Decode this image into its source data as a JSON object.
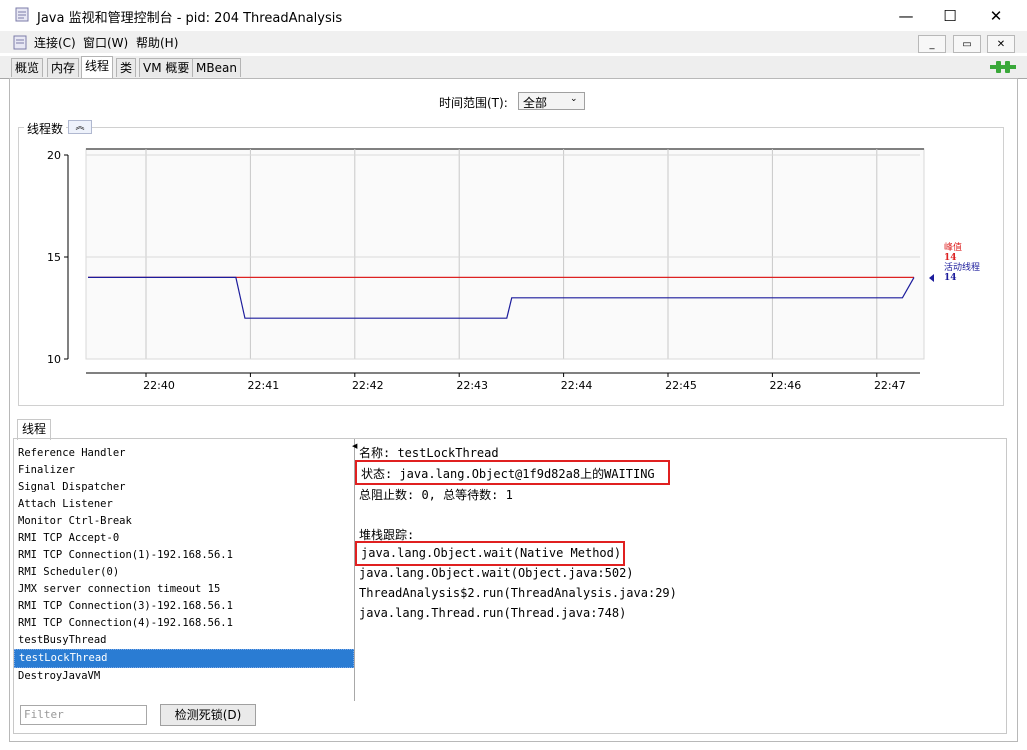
{
  "window": {
    "title": "Java 监视和管理控制台 - pid: 204 ThreadAnalysis",
    "controls": {
      "minimize": "—",
      "maximize": "☐",
      "close": "✕"
    }
  },
  "menu": {
    "items": [
      "连接(C)",
      "窗口(W)",
      "帮助(H)"
    ],
    "mdi_controls": [
      "_",
      "▭",
      "✕"
    ]
  },
  "tabs": [
    "概览",
    "内存",
    "线程",
    "类",
    "VM 概要",
    "MBean"
  ],
  "active_tab": "线程",
  "time_range": {
    "label": "时间范围(T):",
    "value": "全部"
  },
  "chart_data": {
    "type": "line",
    "title": "线程数",
    "x_ticks": [
      "22:40",
      "22:41",
      "22:42",
      "22:43",
      "22:44",
      "22:45",
      "22:46",
      "22:47"
    ],
    "y_ticks": [
      10,
      15,
      20
    ],
    "ylim": [
      10,
      20
    ],
    "series": [
      {
        "name": "峰值",
        "color": "#dd2222",
        "points": [
          [
            0,
            14
          ],
          [
            1,
            14
          ]
        ],
        "last": "14"
      },
      {
        "name": "活动线程",
        "color": "#1c1c9c",
        "points": [
          [
            0,
            14
          ],
          [
            0.179,
            14
          ],
          [
            0.19,
            12
          ],
          [
            0.507,
            12
          ],
          [
            0.513,
            13
          ],
          [
            0.986,
            13
          ],
          [
            1,
            14
          ]
        ],
        "last": "14"
      }
    ]
  },
  "thread_panel": {
    "tab_label": "线程",
    "threads": [
      "Reference Handler",
      "Finalizer",
      "Signal Dispatcher",
      "Attach Listener",
      "Monitor Ctrl-Break",
      "RMI TCP Accept-0",
      "RMI TCP Connection(1)-192.168.56.1",
      "RMI Scheduler(0)",
      "JMX server connection timeout 15",
      "RMI TCP Connection(3)-192.168.56.1",
      "RMI TCP Connection(4)-192.168.56.1",
      "testBusyThread",
      "testLockThread",
      "DestroyJavaVM"
    ],
    "selected": "testLockThread",
    "filter_placeholder": "Filter",
    "detect_deadlock_label": "检测死锁(D)"
  },
  "details": {
    "name_line": "名称: testLockThread",
    "state_line": "状态: java.lang.Object@1f9d82a8上的WAITING",
    "counts_line": "总阻止数: 0, 总等待数: 1",
    "stack_header": "堆栈跟踪:",
    "stack": [
      "java.lang.Object.wait(Native Method)",
      "java.lang.Object.wait(Object.java:502)",
      "ThreadAnalysis$2.run(ThreadAnalysis.java:29)",
      "java.lang.Thread.run(Thread.java:748)"
    ]
  },
  "colors": {
    "selection": "#2a7cd3",
    "highlight_box": "#e02020",
    "connection_icon": "#3aa83a"
  }
}
